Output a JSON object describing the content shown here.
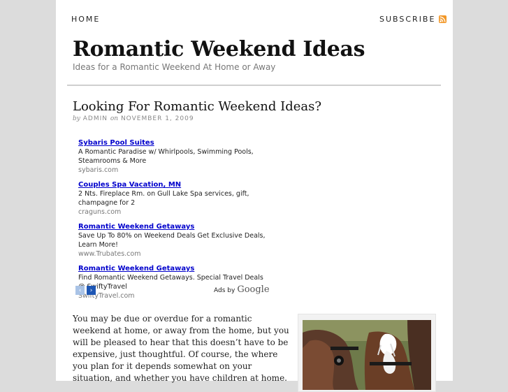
{
  "nav": {
    "home_label": "HOME",
    "subscribe_label": "SUBSCRIBE"
  },
  "site": {
    "title": "Romantic Weekend Ideas",
    "tagline": "Ideas for a Romantic Weekend At Home or Away"
  },
  "post": {
    "title": "Looking For Romantic Weekend Ideas?",
    "byline_by": "by",
    "author": "ADMIN",
    "byline_on": "on",
    "date": "NOVEMBER 1, 2009",
    "body": "You may be due or overdue for a romantic weekend at home, or away from the home, but you will be pleased to hear that this doesn’t have to be expensive, just thoughtful. Of course, the where you plan for it depends somewhat on your situation, and whether you have children at home."
  },
  "ads": {
    "items": [
      {
        "title": "Sybaris Pool Suites",
        "desc": "A Romantic Paradise w/ Whirlpools, Swimming Pools, Steamrooms & More",
        "url": "sybaris.com"
      },
      {
        "title": "Couples Spa Vacation, MN",
        "desc": "2 Nts. Fireplace Rm. on Gull Lake Spa services, gift, champagne for 2",
        "url": "craguns.com"
      },
      {
        "title": "Romantic Weekend Getaways",
        "desc": "Save Up To 80% on Weekend Deals Get Exclusive Deals, Learn More!",
        "url": "www.Trubates.com"
      },
      {
        "title": "Romantic Weekend Getaways",
        "desc": "Find Romantic Weekend Getaways. Special Travel Deals @ SwiftyTravel",
        "url": "SwiftyTravel.com"
      }
    ],
    "ads_by_label": "Ads by",
    "google_label": "Google",
    "prev_arrow": "‹",
    "next_arrow": "›"
  },
  "colors": {
    "background": "#dcdcdc",
    "ad_link": "#0000cc",
    "rss": "#f29727"
  },
  "icons": {
    "subscribe": "rss-feed-icon",
    "ad_prev": "chevron-left-icon",
    "ad_next": "chevron-right-icon"
  }
}
